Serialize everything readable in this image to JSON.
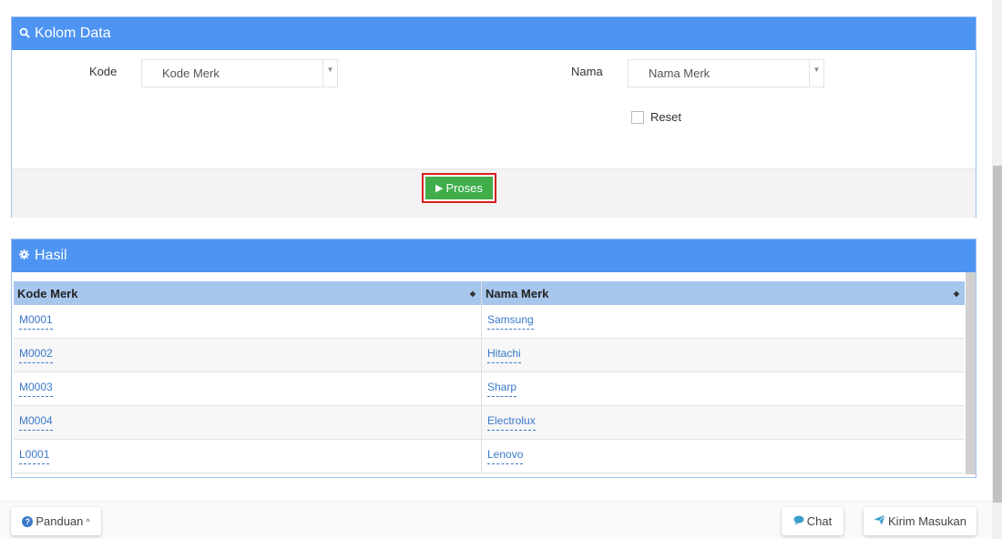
{
  "kolom_panel": {
    "title": "Kolom Data",
    "kode_label": "Kode",
    "kode_value": "Kode Merk",
    "nama_label": "Nama",
    "nama_value": "Nama Merk",
    "reset_label": "Reset",
    "reset_checked": false,
    "proses_label": "Proses"
  },
  "hasil_panel": {
    "title": "Hasil",
    "columns": [
      "Kode Merk",
      "Nama Merk"
    ],
    "rows": [
      {
        "kode": "M0001",
        "nama": "Samsung"
      },
      {
        "kode": "M0002",
        "nama": "Hitachi"
      },
      {
        "kode": "M0003",
        "nama": "Sharp"
      },
      {
        "kode": "M0004",
        "nama": "Electrolux"
      },
      {
        "kode": "L0001",
        "nama": "Lenovo"
      }
    ]
  },
  "bottom_bar": {
    "panduan_label": "Panduan",
    "chat_label": "Chat",
    "kirim_label": "Kirim Masukan"
  },
  "icons": {
    "kolom_header": "search-icon",
    "hasil_header": "gear-icon",
    "proses": "play-icon",
    "panduan": "question-circle-icon",
    "chat": "chat-bubble-icon",
    "kirim": "paper-plane-icon"
  },
  "colors": {
    "header_blue": "#4e94f3",
    "proses_green": "#3fae49",
    "highlight_red": "#d61f1f",
    "table_header": "#a7c6ec",
    "link_blue": "#3a78c9"
  }
}
